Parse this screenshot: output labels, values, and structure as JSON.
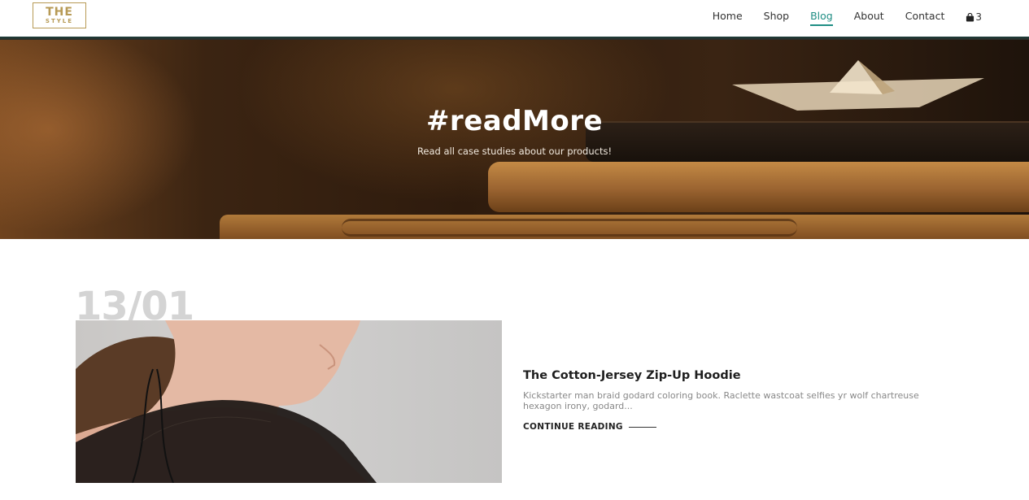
{
  "brand": {
    "logo_main": "THE",
    "logo_sub": "STYLE",
    "color": "#b79a55"
  },
  "nav": {
    "items": [
      {
        "label": "Home",
        "active": false
      },
      {
        "label": "Shop",
        "active": false
      },
      {
        "label": "Blog",
        "active": true
      },
      {
        "label": "About",
        "active": false
      },
      {
        "label": "Contact",
        "active": false
      }
    ],
    "cart_count": "3",
    "cart_icon": "shopping-bag-icon",
    "active_color": "#1f8e84"
  },
  "hero": {
    "title": "#readMore",
    "subtitle": "Read all case studies about our products!"
  },
  "post": {
    "date": "13/01",
    "title": "The Cotton-Jersey Zip-Up Hoodie",
    "excerpt": "Kickstarter man braid godard coloring book. Raclette wastcoat selfies yr wolf chartreuse hexagon irony, godard...",
    "cta": "CONTINUE READING"
  }
}
